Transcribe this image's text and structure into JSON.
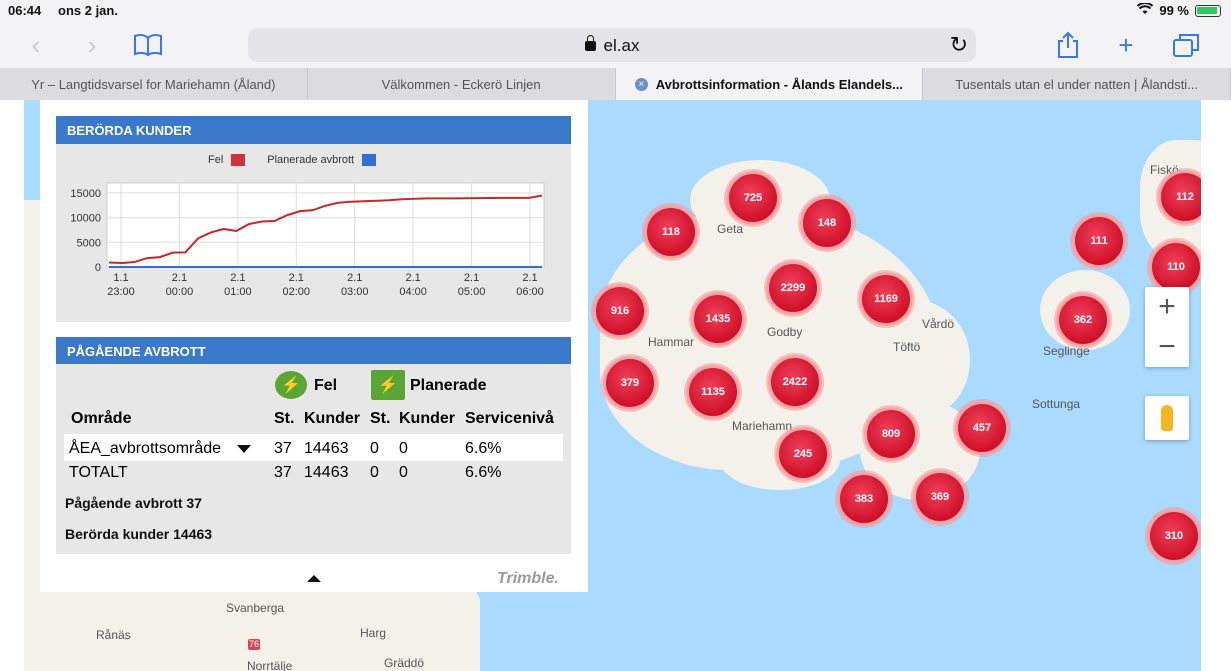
{
  "status": {
    "time": "06:44",
    "date": "ons 2 jan.",
    "battery": "99 %"
  },
  "browser": {
    "url": "el.ax",
    "tabs": [
      {
        "label": "Yr – Langtidsvarsel for Mariehamn (Åland)",
        "active": false
      },
      {
        "label": "Välkommen - Eckerö Linjen",
        "active": false
      },
      {
        "label": "Avbrottsinformation - Ålands Elandels...",
        "active": true
      },
      {
        "label": "Tusentals utan el under natten | Ålandsti...",
        "active": false
      }
    ]
  },
  "panel": {
    "affected_title": "BERÖRDA KUNDER",
    "ongoing_title": "PÅGÅENDE AVBROTT",
    "legend": {
      "fel": "Fel",
      "planned": "Planerade avbrott",
      "fel_color": "#d32f3a",
      "planned_color": "#2e6fd6"
    },
    "table": {
      "fel_group": "Fel",
      "planned_group": "Planerade",
      "headers": [
        "Område",
        "St.",
        "Kunder",
        "St.",
        "Kunder",
        "Servicenivå"
      ],
      "rows": [
        [
          "ÅEA_avbrottsområde",
          "37",
          "14463",
          "0",
          "0",
          "6.6%"
        ],
        [
          "TOTALT",
          "37",
          "14463",
          "0",
          "0",
          "6.6%"
        ]
      ]
    },
    "summary_ongoing": "Pågående avbrott 37",
    "summary_customers": "Berörda kunder 14463",
    "brand": "Trimble."
  },
  "chart_data": {
    "type": "line",
    "x": [
      "1.1 23:00",
      "2.1 00:00",
      "2.1 01:00",
      "2.1 02:00",
      "2.1 03:00",
      "2.1 04:00",
      "2.1 05:00",
      "2.1 06:00"
    ],
    "x_tick_top": [
      "1.1",
      "2.1",
      "2.1",
      "2.1",
      "2.1",
      "2.1",
      "2.1",
      "2.1"
    ],
    "x_tick_bottom": [
      "23:00",
      "00:00",
      "01:00",
      "02:00",
      "03:00",
      "04:00",
      "05:00",
      "06:00"
    ],
    "y_ticks": [
      "15000",
      "10000",
      "5000",
      "0"
    ],
    "ylim": [
      0,
      17000
    ],
    "series": [
      {
        "name": "Fel",
        "color": "#c62828",
        "points": [
          [
            0,
            900
          ],
          [
            0.2,
            800
          ],
          [
            0.4,
            1000
          ],
          [
            0.6,
            1800
          ],
          [
            0.8,
            2000
          ],
          [
            1.0,
            2900
          ],
          [
            1.2,
            2950
          ],
          [
            1.4,
            5800
          ],
          [
            1.6,
            7000
          ],
          [
            1.8,
            7700
          ],
          [
            2.0,
            7300
          ],
          [
            2.2,
            8700
          ],
          [
            2.4,
            9200
          ],
          [
            2.6,
            9300
          ],
          [
            2.8,
            10500
          ],
          [
            3.0,
            11300
          ],
          [
            3.2,
            11500
          ],
          [
            3.4,
            12400
          ],
          [
            3.6,
            13000
          ],
          [
            3.8,
            13200
          ],
          [
            4.0,
            13300
          ],
          [
            4.2,
            13400
          ],
          [
            4.4,
            13500
          ],
          [
            4.6,
            13700
          ],
          [
            4.8,
            13800
          ],
          [
            5.0,
            13900
          ],
          [
            5.4,
            13900
          ],
          [
            5.8,
            13950
          ],
          [
            6.2,
            14000
          ],
          [
            6.6,
            14000
          ],
          [
            6.8,
            14463
          ]
        ]
      },
      {
        "name": "Planerade avbrott",
        "color": "#2e6fd6",
        "points": [
          [
            0,
            0
          ],
          [
            6.8,
            0
          ]
        ]
      }
    ]
  },
  "map": {
    "labels": [
      {
        "text": "Geta"
      },
      {
        "text": "Godby"
      },
      {
        "text": "Hammar"
      },
      {
        "text": "Mariehamn"
      },
      {
        "text": "Vårdö"
      },
      {
        "text": "Töftö"
      },
      {
        "text": "Seglinge"
      },
      {
        "text": "Sottunga"
      },
      {
        "text": "Fiskö"
      },
      {
        "text": "Svanberga"
      },
      {
        "text": "Rånäs"
      },
      {
        "text": "Harg"
      },
      {
        "text": "Norrtälje"
      },
      {
        "text": "Gräddö"
      }
    ],
    "clusters": [
      "725",
      "118",
      "148",
      "111",
      "112",
      "110",
      "2299",
      "1169",
      "916",
      "1435",
      "362",
      "379",
      "1135",
      "2422",
      "809",
      "457",
      "245",
      "383",
      "369",
      "310"
    ],
    "road_badge": "76"
  }
}
